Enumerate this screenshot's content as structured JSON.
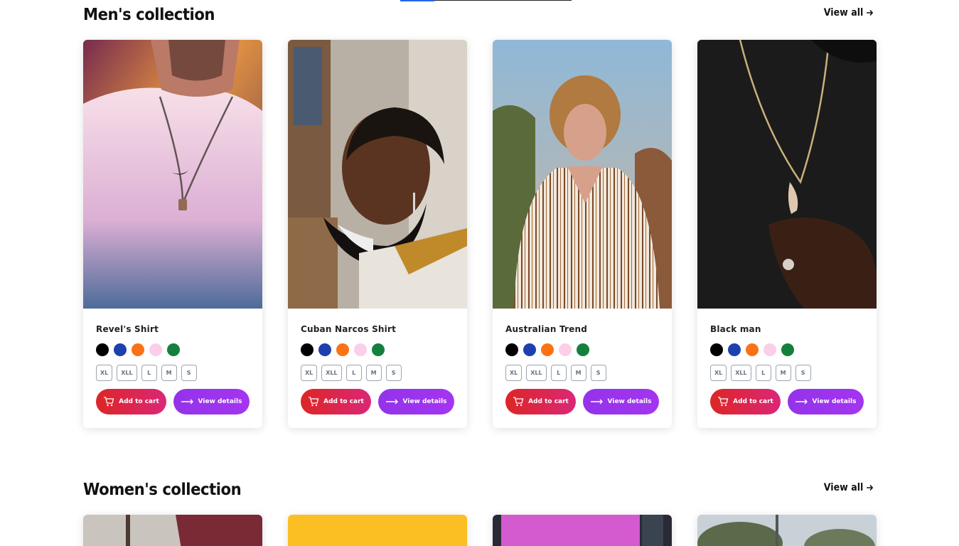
{
  "men": {
    "title": "Men's collection",
    "view_all": "View all",
    "products": [
      {
        "name": "Revel's Shirt"
      },
      {
        "name": "Cuban Narcos Shirt"
      },
      {
        "name": "Australian Trend"
      },
      {
        "name": "Black man"
      }
    ]
  },
  "women": {
    "title": "Women's collection",
    "view_all": "View all"
  },
  "colors": [
    "#000000",
    "#1e40af",
    "#f97316",
    "#fbcfe8",
    "#15803d"
  ],
  "sizes": [
    "XL",
    "XLL",
    "L",
    "M",
    "S"
  ],
  "buttons": {
    "add_to_cart": "Add to cart",
    "view_details": "View details"
  },
  "accent": {
    "cart_gradient": [
      "#dc2626",
      "#db2777"
    ],
    "view_gradient": [
      "#9333ea",
      "#a435f0"
    ]
  }
}
